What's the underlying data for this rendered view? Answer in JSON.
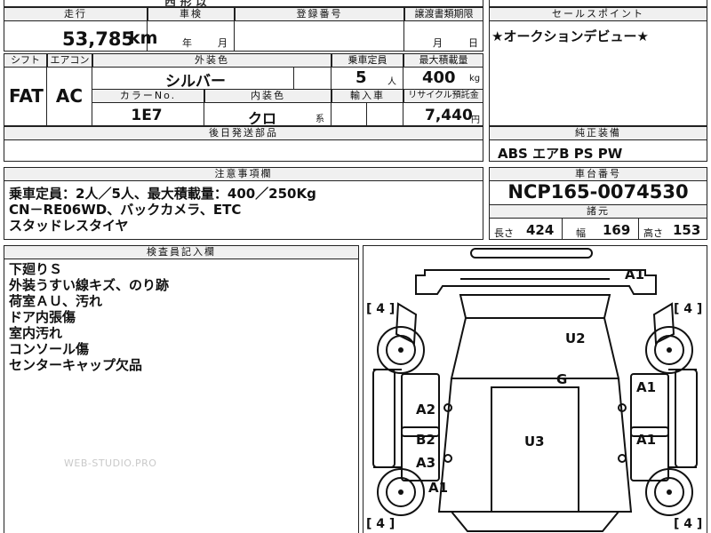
{
  "header": {
    "mileage_label": "走行",
    "inspection_label": "車検",
    "registration_label": "登録番号",
    "transfer_label": "譲渡書類期限",
    "sales_point_label": "セールスポイント",
    "top_partial_text": "西 形 以"
  },
  "vehicle": {
    "mileage": "53,785",
    "mileage_unit": "km",
    "inspection_year_unit": "年",
    "inspection_month_unit": "月",
    "transfer_month_unit": "月",
    "transfer_day_unit": "日",
    "sales_point": "★オークションデビュー★"
  },
  "specs": {
    "shift_label": "シフト",
    "aircon_label": "エアコン",
    "exterior_label": "外装色",
    "capacity_label": "乗車定員",
    "max_load_label": "最大積載量",
    "shift": "FAT",
    "aircon": "AC",
    "exterior_color": "シルバー",
    "capacity": "5",
    "capacity_unit": "人",
    "max_load": "400",
    "max_load_unit": "kg",
    "color_no_label": "カラーNo.",
    "interior_label": "内装色",
    "import_label": "輸入車",
    "recycle_label": "リサイクル預託金",
    "color_no": "1E7",
    "interior_color": "クロ",
    "interior_suffix": "系",
    "recycle_fee": "7,440",
    "recycle_unit": "円",
    "later_parts_label": "後日発送部品"
  },
  "equipment": {
    "label": "純正装備",
    "items": "ABS エアB PS PW"
  },
  "notes": {
    "label": "注意事項欄",
    "lines": [
      "乗車定員：2人／5人、最大積載量：400／250Kg",
      "CN－RE06WD、バックカメラ、ETC",
      "スタッドレスタイヤ"
    ]
  },
  "chassis": {
    "label": "車台番号",
    "number": "NCP165-0074530",
    "dims_label": "諸元",
    "length_label": "長さ",
    "length": "424",
    "width_label": "幅",
    "width": "169",
    "height_label": "高さ",
    "height": "153"
  },
  "inspector": {
    "label": "検査員記入欄",
    "lines": [
      "下廻りＳ",
      "外装うすい線キズ、のり跡",
      "荷室ＡＵ、汚れ",
      "ドア内張傷",
      "室内汚れ",
      "コンソール傷",
      "センターキャップ欠品"
    ]
  },
  "diagram": {
    "tire_marks": [
      "[ 4 ]",
      "[ 4 ]",
      "[ 4 ]",
      "[ 4 ]"
    ],
    "marks": [
      "A1",
      "U2",
      "G",
      "A1",
      "A2",
      "B2",
      "U3",
      "A1",
      "A3",
      "A1"
    ]
  },
  "watermark": "WEB-STUDIO.PRO"
}
